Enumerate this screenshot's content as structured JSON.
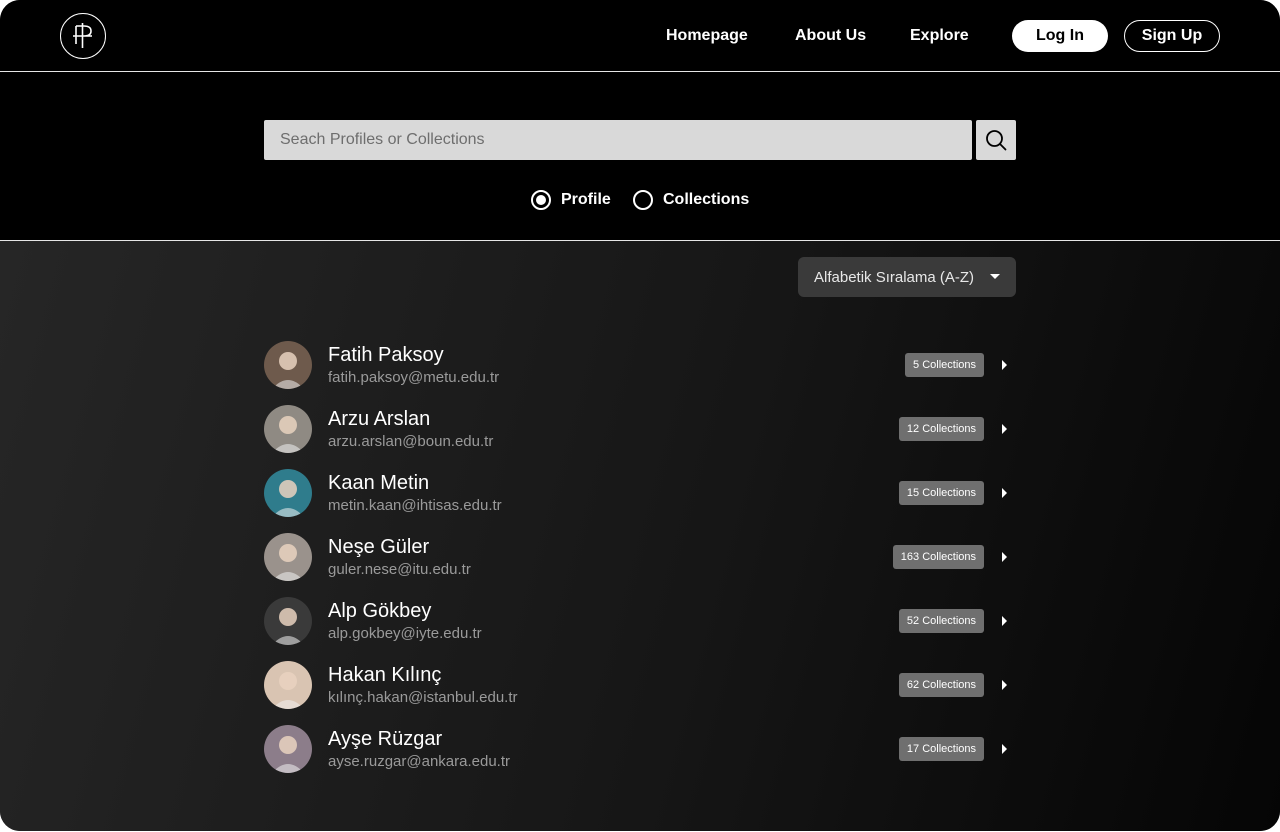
{
  "nav": {
    "logo_icon": "monogram-logo-icon",
    "links": [
      "Homepage",
      "About Us",
      "Explore"
    ],
    "login_label": "Log In",
    "signup_label": "Sign Up"
  },
  "search": {
    "placeholder": "Seach Profiles or Collections",
    "value": "",
    "button_icon": "search-icon",
    "radio_options": [
      {
        "label": "Profile",
        "checked": true
      },
      {
        "label": "Collections",
        "checked": false
      }
    ]
  },
  "sort": {
    "selected": "Alfabetik Sıralama (A-Z)",
    "icon": "caret-down-icon"
  },
  "profiles": [
    {
      "name": "Fatih Paksoy",
      "email": "fatih.paksoy@metu.edu.tr",
      "collections": "5 Collections",
      "avatar_color": "#6e5a4c"
    },
    {
      "name": "Arzu Arslan",
      "email": "arzu.arslan@boun.edu.tr",
      "collections": "12 Collections",
      "avatar_color": "#8f8a83"
    },
    {
      "name": "Kaan Metin",
      "email": "metin.kaan@ihtisas.edu.tr",
      "collections": "15 Collections",
      "avatar_color": "#2f7c8c"
    },
    {
      "name": "Neşe Güler",
      "email": "guler.nese@itu.edu.tr",
      "collections": "163 Collections",
      "avatar_color": "#9a928c"
    },
    {
      "name": "Alp Gökbey",
      "email": "alp.gokbey@iyte.edu.tr",
      "collections": "52 Collections",
      "avatar_color": "#3a3a3a"
    },
    {
      "name": "Hakan Kılınç",
      "email": "kılınç.hakan@istanbul.edu.tr",
      "collections": "62 Collections",
      "avatar_color": "#d9c4b2"
    },
    {
      "name": "Ayşe Rüzgar",
      "email": "ayse.ruzgar@ankara.edu.tr",
      "collections": "17 Collections",
      "avatar_color": "#8c7d8a"
    }
  ]
}
